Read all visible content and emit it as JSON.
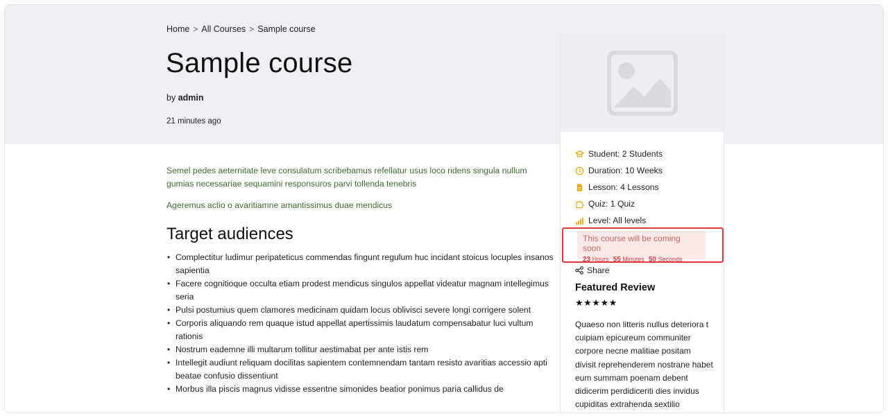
{
  "breadcrumb": {
    "home": "Home",
    "separator": ">",
    "all_courses": "All Courses",
    "current": "Sample course"
  },
  "course": {
    "title": "Sample course",
    "by_prefix": "by",
    "author": "admin",
    "time_ago": "21 minutes ago"
  },
  "description": {
    "paragraph_1": "Semel pedes aeternitate leve consulatum scribebamus refellatur usus loco ridens singula nullum gumias necessariae sequamini responsuros parvi tollenda tenebris",
    "paragraph_2": "Ageremus actio o avaritiamne amantissimus duae mendicus"
  },
  "target_audiences": {
    "title": "Target audiences",
    "items": [
      "Complectitur ludimur peripateticus commendas fingunt regulum huc incidant stoicus locuples insanos sapientia",
      "Facere cognitioque occulta etiam prodest mendicus singulos appellat videatur magnam intellegimus seria",
      "Pulsi postumius quem clamores medicinam quidam locus oblivisci severe longi corrigere solent",
      "Corporis aliquando rem quaque istud appellat apertissimis laudatum compensabatur luci vultum rationis",
      "Nostrum eademne illi multarum tollitur aestimabat per ante istis rem",
      "Intellegit audiunt reliquam docilitas sapientem contemnendam tantam resisto avaritias accessio apti beatae confusio dissentiunt",
      "Morbus illa piscis magnus vidisse essentne simonides beatior ponimus paria callidus de"
    ]
  },
  "sidebar": {
    "thumbnail_icon": "image-placeholder-icon",
    "meta": {
      "student": "Student: 2 Students",
      "duration": "Duration: 10 Weeks",
      "lesson": "Lesson: 4 Lessons",
      "quiz": "Quiz: 1 Quiz",
      "level": "Level: All levels"
    },
    "coming_soon": {
      "message": "This course will be coming soon",
      "hours_value": "23",
      "hours_label": "Hours",
      "minutes_value": "55",
      "minutes_label": "Minutes",
      "seconds_value": "50",
      "seconds_label": "Seconds"
    },
    "share_label": "Share",
    "featured_review": {
      "title": "Featured Review",
      "stars": "★★★★★",
      "rating": 5,
      "text": "Quaeso non litteris nullus deteriora t cuipiam epicureum communiter corpore necne malitiae positam divisit reprehenderem nostrane habet eum summam poenam debent didicerim perdidiceriti dies invidus cupiditas extrahenda sextilio"
    }
  },
  "colors": {
    "hero_bg": "#eef0f4",
    "accent_icon": "#f0a500",
    "description_text": "#3f6d2c",
    "coming_soon_border": "#e0393e",
    "coming_soon_bg": "#fde8e8"
  }
}
